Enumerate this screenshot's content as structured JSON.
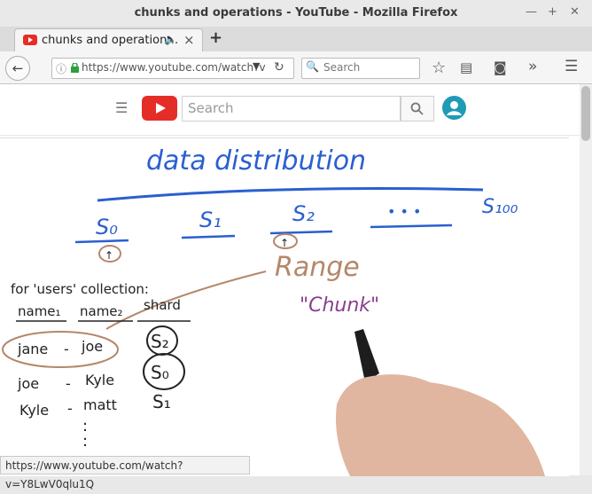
{
  "window": {
    "title": "chunks and operations - YouTube - Mozilla Firefox"
  },
  "tab": {
    "label": "chunks and operation…",
    "new_tab": "+",
    "close": "×"
  },
  "navbar": {
    "url": "https://www.youtube.com/watch?v",
    "search_placeholder": "Search"
  },
  "youtube": {
    "search_placeholder": "Search"
  },
  "whiteboard": {
    "heading": "data distribution",
    "shards": [
      "S₀",
      "S₁",
      "S₂",
      "• • •",
      "S₁₀₀"
    ],
    "range_label": "Range",
    "chunk_label": "\"Chunk\"",
    "collection_label": "for 'users' collection:",
    "col_name1": "name₁",
    "col_name2": "name₂",
    "col_shard": "shard",
    "rows": [
      {
        "name1": "jane",
        "sep": "-",
        "name2": "joe",
        "shard": "S₂"
      },
      {
        "name1": "joe",
        "sep": "-",
        "name2": "Kyle",
        "shard": "S₀"
      },
      {
        "name1": "Kyle",
        "sep": "-",
        "name2": "matt",
        "shard": "S₁"
      }
    ],
    "ellipsis": ":"
  },
  "statusbar": {
    "url": "https://www.youtube.com/watch?v=Y8LwV0qlu1Q"
  },
  "colors": {
    "ink_blue": "#2a5fd0",
    "ink_brown": "#b5876a",
    "ink_purple": "#8a3f8f",
    "ink_black": "#222222",
    "yt_red": "#e52d27",
    "avatar": "#1e9bb5"
  }
}
